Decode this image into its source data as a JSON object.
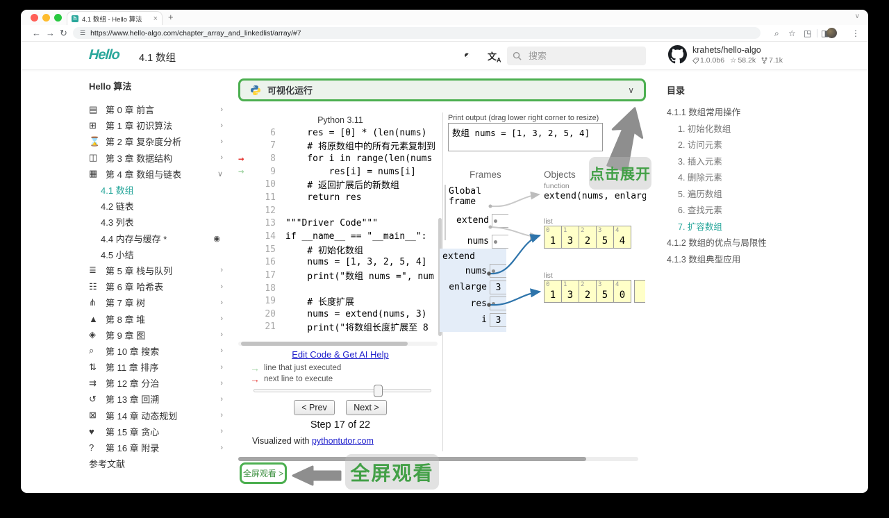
{
  "colors": {
    "accent_teal": "#26a69a",
    "highlight_green": "#4caf50",
    "annotation_green": "#43a047",
    "red_arrow": "#e53935",
    "green_arrow": "#a5d6a7",
    "list_yellow": "#ffffc8",
    "frame_blue": "#e4edf8",
    "blue_pointer": "#2e74ab"
  },
  "browser": {
    "tab_title": "4.1 数组 - Hello 算法",
    "close_tab": "×",
    "new_tab": "+",
    "url": "https://www.hello-algo.com/chapter_array_and_linkedlist/array/#7"
  },
  "header": {
    "logo_text": "Hello",
    "page_title": "4.1 数组",
    "search_placeholder": "搜索",
    "repo_name": "krahets/hello-algo",
    "repo_version": "1.0.0b6",
    "repo_stars": "58.2k",
    "repo_forks": "7.1k"
  },
  "sidebar": {
    "title": "Hello 算法",
    "items": [
      {
        "type": "chapter",
        "icon": "▤",
        "label": "第 0 章  前言",
        "chevron": "›"
      },
      {
        "type": "chapter",
        "icon": "⊞",
        "label": "第 1 章  初识算法",
        "chevron": "›"
      },
      {
        "type": "chapter",
        "icon": "⌛",
        "label": "第 2 章  复杂度分析",
        "chevron": "›"
      },
      {
        "type": "chapter",
        "icon": "◫",
        "label": "第 3 章  数据结构",
        "chevron": "›"
      },
      {
        "type": "chapter",
        "icon": "▦",
        "label": "第 4 章  数组与链表",
        "chevron": "∨"
      },
      {
        "type": "sub",
        "label": "4.1  数组",
        "active": true
      },
      {
        "type": "sub",
        "label": "4.2  链表"
      },
      {
        "type": "sub",
        "label": "4.3  列表"
      },
      {
        "type": "sub",
        "label": "4.4  内存与缓存 *",
        "badge": "◉"
      },
      {
        "type": "sub",
        "label": "4.5  小结"
      },
      {
        "type": "chapter",
        "icon": "≣",
        "label": "第 5 章  栈与队列",
        "chevron": "›"
      },
      {
        "type": "chapter",
        "icon": "☷",
        "label": "第 6 章  哈希表",
        "chevron": "›"
      },
      {
        "type": "chapter",
        "icon": "⋔",
        "label": "第 7 章  树",
        "chevron": "›"
      },
      {
        "type": "chapter",
        "icon": "▲",
        "label": "第 8 章  堆",
        "chevron": "›"
      },
      {
        "type": "chapter",
        "icon": "◈",
        "label": "第 9 章  图",
        "chevron": "›"
      },
      {
        "type": "chapter",
        "icon": "⌕",
        "label": "第 10 章  搜索",
        "chevron": "›"
      },
      {
        "type": "chapter",
        "icon": "⇅",
        "label": "第 11 章  排序",
        "chevron": "›"
      },
      {
        "type": "chapter",
        "icon": "⇉",
        "label": "第 12 章  分治",
        "chevron": "›"
      },
      {
        "type": "chapter",
        "icon": "↺",
        "label": "第 13 章  回溯",
        "chevron": "›"
      },
      {
        "type": "chapter",
        "icon": "⊠",
        "label": "第 14 章  动态规划",
        "chevron": "›"
      },
      {
        "type": "chapter",
        "icon": "♥",
        "label": "第 15 章  贪心",
        "chevron": "›"
      },
      {
        "type": "chapter",
        "icon": "?",
        "label": "第 16 章  附录",
        "chevron": "›"
      },
      {
        "type": "plain",
        "label": "参考文献"
      }
    ]
  },
  "panel": {
    "title": "可视化运行",
    "chevron": "∨"
  },
  "tutor": {
    "lang_label": "Python 3.11",
    "code_lines": [
      {
        "n": "6",
        "t": "    res = [0] * (len(nums)"
      },
      {
        "n": "7",
        "t": "    # 将原数组中的所有元素复制到"
      },
      {
        "n": "8",
        "t": "    for i in range(len(nums",
        "arrow": "red"
      },
      {
        "n": "9",
        "t": "        res[i] = nums[i]",
        "arrow": "green"
      },
      {
        "n": "10",
        "t": "    # 返回扩展后的新数组"
      },
      {
        "n": "11",
        "t": "    return res"
      },
      {
        "n": "12",
        "t": ""
      },
      {
        "n": "13",
        "t": "\"\"\"Driver Code\"\"\""
      },
      {
        "n": "14",
        "t": "if __name__ == \"__main__\":"
      },
      {
        "n": "15",
        "t": "    # 初始化数组"
      },
      {
        "n": "16",
        "t": "    nums = [1, 3, 2, 5, 4]"
      },
      {
        "n": "17",
        "t": "    print(\"数组 nums =\", num"
      },
      {
        "n": "18",
        "t": ""
      },
      {
        "n": "19",
        "t": "    # 长度扩展"
      },
      {
        "n": "20",
        "t": "    nums = extend(nums, 3)"
      },
      {
        "n": "21",
        "t": "    print(\"将数组长度扩展至 8"
      }
    ],
    "edit_link": "Edit Code & Get AI Help",
    "legend_executed": "line that just executed",
    "legend_next": "next line to execute",
    "prev_label": "< Prev",
    "next_label": "Next >",
    "step_label": "Step 17 of 22",
    "credit_prefix": "Visualized with ",
    "credit_link": "pythontutor.com",
    "print_label": "Print output (drag lower right corner to resize)",
    "print_value": "数组 nums = [1, 3, 2, 5, 4]",
    "frames_header": "Frames",
    "objects_header": "Objects",
    "global_frame": {
      "label": "Global frame",
      "vars": [
        {
          "name": "extend",
          "kind": "ref"
        },
        {
          "name": "nums",
          "kind": "ref"
        }
      ]
    },
    "extend_frame": {
      "label": "extend",
      "vars": [
        {
          "name": "nums",
          "kind": "ref"
        },
        {
          "name": "enlarge",
          "value": "3"
        },
        {
          "name": "res",
          "kind": "ref"
        },
        {
          "name": "i",
          "value": "3"
        }
      ]
    },
    "function_obj": {
      "type_label": "function",
      "signature": "extend(nums, enlarg"
    },
    "list1": {
      "type_label": "list",
      "cells": [
        {
          "i": "0",
          "v": "1"
        },
        {
          "i": "1",
          "v": "3"
        },
        {
          "i": "2",
          "v": "2"
        },
        {
          "i": "3",
          "v": "5"
        },
        {
          "i": "4",
          "v": "4"
        }
      ]
    },
    "list2": {
      "type_label": "list",
      "cells": [
        {
          "i": "0",
          "v": "1"
        },
        {
          "i": "1",
          "v": "3"
        },
        {
          "i": "2",
          "v": "2"
        },
        {
          "i": "3",
          "v": "5"
        },
        {
          "i": "4",
          "v": "0"
        }
      ]
    }
  },
  "annotations": {
    "expand": "点击展开",
    "fullscreen": "全屏观看",
    "fullscreen_link": "全屏观看 >"
  },
  "toc": {
    "title": "目录",
    "items": [
      {
        "label": "4.1.1  数组常用操作",
        "level": "l1"
      },
      {
        "label": "1.  初始化数组",
        "level": "l2"
      },
      {
        "label": "2.  访问元素",
        "level": "l2"
      },
      {
        "label": "3.  插入元素",
        "level": "l2"
      },
      {
        "label": "4.  删除元素",
        "level": "l2"
      },
      {
        "label": "5.  遍历数组",
        "level": "l2"
      },
      {
        "label": "6.  查找元素",
        "level": "l2"
      },
      {
        "label": "7.  扩容数组",
        "level": "l2",
        "active": true
      },
      {
        "label": "4.1.2  数组的优点与局限性",
        "level": "l1"
      },
      {
        "label": "4.1.3  数组典型应用",
        "level": "l1"
      }
    ]
  }
}
